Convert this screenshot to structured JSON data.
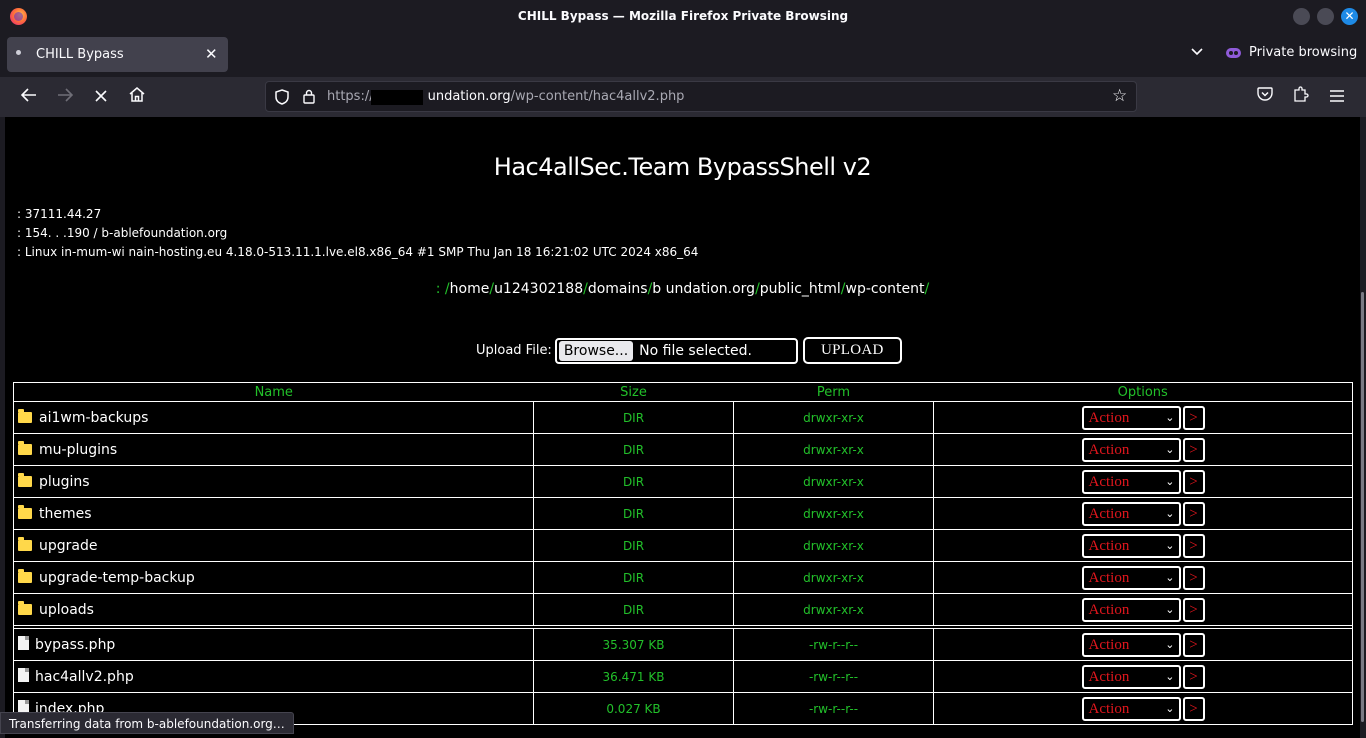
{
  "window": {
    "title": "CHILL Bypass — Mozilla Firefox Private Browsing"
  },
  "tab": {
    "label": "CHILL Bypass"
  },
  "private": {
    "label": "Private browsing"
  },
  "urlbar": {
    "url_prefix": "https://",
    "url_host": "undation.org",
    "url_path": "/wp-content/hac4allv2.php"
  },
  "page": {
    "title": "Hac4allSec.Team BypassShell v2",
    "info_lines": [
      ": 37111.44.27",
      ": 154.  .  .190 / b-ablefoundation.org",
      ": Linux in-mum-wi           nain-hosting.eu 4.18.0-513.11.1.lve.el8.x86_64 #1 SMP Thu Jan 18 16:21:02 UTC 2024 x86_64"
    ],
    "path_prefix": ": ",
    "path_parts": [
      "home",
      "u124302188",
      "domains",
      "b            undation.org",
      "public_html",
      "wp-content"
    ],
    "upload": {
      "label": "Upload File:",
      "browse": "Browse...",
      "status": "No file selected.",
      "submit": "UPLOAD"
    },
    "columns": [
      "Name",
      "Size",
      "Perm",
      "Options"
    ],
    "dirs": [
      {
        "name": "ai1wm-backups",
        "size": "DIR",
        "perm": "drwxr-xr-x"
      },
      {
        "name": "mu-plugins",
        "size": "DIR",
        "perm": "drwxr-xr-x"
      },
      {
        "name": "plugins",
        "size": "DIR",
        "perm": "drwxr-xr-x"
      },
      {
        "name": "themes",
        "size": "DIR",
        "perm": "drwxr-xr-x"
      },
      {
        "name": "upgrade",
        "size": "DIR",
        "perm": "drwxr-xr-x"
      },
      {
        "name": "upgrade-temp-backup",
        "size": "DIR",
        "perm": "drwxr-xr-x"
      },
      {
        "name": "uploads",
        "size": "DIR",
        "perm": "drwxr-xr-x"
      }
    ],
    "files": [
      {
        "name": "bypass.php",
        "size": "35.307 KB",
        "perm": "-rw-r--r--"
      },
      {
        "name": "hac4allv2.php",
        "size": "36.471 KB",
        "perm": "-rw-r--r--"
      },
      {
        "name": "index.php",
        "size": "0.027 KB",
        "perm": "-rw-r--r--"
      }
    ],
    "action_label": "Action",
    "go_label": ">"
  },
  "status": {
    "text": "Transferring data from b-ablefoundation.org…"
  }
}
